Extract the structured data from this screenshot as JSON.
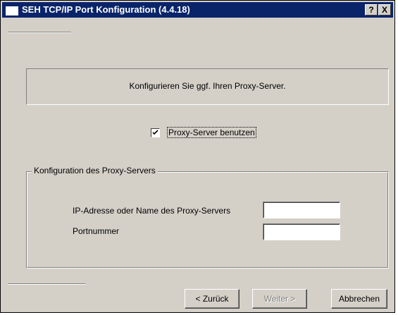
{
  "window": {
    "title": "SEH TCP/IP Port Konfiguration (4.4.18)",
    "help_button": "?",
    "close_button": "X"
  },
  "info": {
    "text": "Konfigurieren Sie ggf. Ihren Proxy-Server."
  },
  "proxy_checkbox": {
    "label": "Proxy-Server benutzen",
    "checked": true
  },
  "proxy_group": {
    "legend": "Konfiguration des Proxy-Servers",
    "address_label": "IP-Adresse oder Name des Proxy-Servers",
    "address_value": "",
    "port_label": "Portnummer",
    "port_value": ""
  },
  "buttons": {
    "back": "< Zurück",
    "next": "Weiter >",
    "cancel": "Abbrechen"
  }
}
